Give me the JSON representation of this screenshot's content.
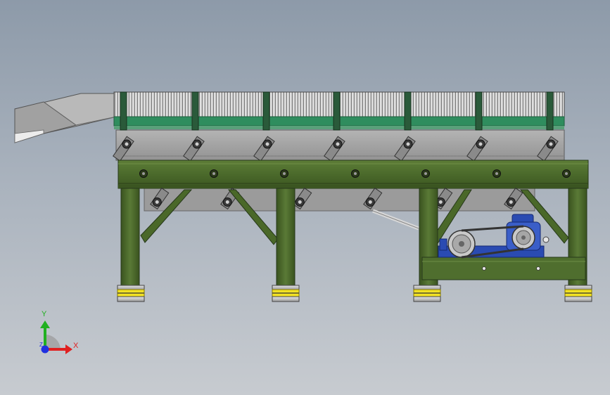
{
  "scene": {
    "model": "vibrating-feeder-assembly",
    "colors": {
      "background_top": "#8d9aa9",
      "background_bottom": "#c7cbd0",
      "frame_green": "#4d6b2c",
      "frame_green_dark": "#35491d",
      "deck_green": "#2f8d5e",
      "trough_gray": "#a4a4a4",
      "motor_blue": "#2a4bb2",
      "isolator_yellow": "#f2e225"
    }
  },
  "triad": {
    "x_label": "X",
    "y_label": "Y",
    "z_label": "Z",
    "x_color": "#e02020",
    "y_color": "#20b020",
    "z_color": "#2030e0"
  }
}
